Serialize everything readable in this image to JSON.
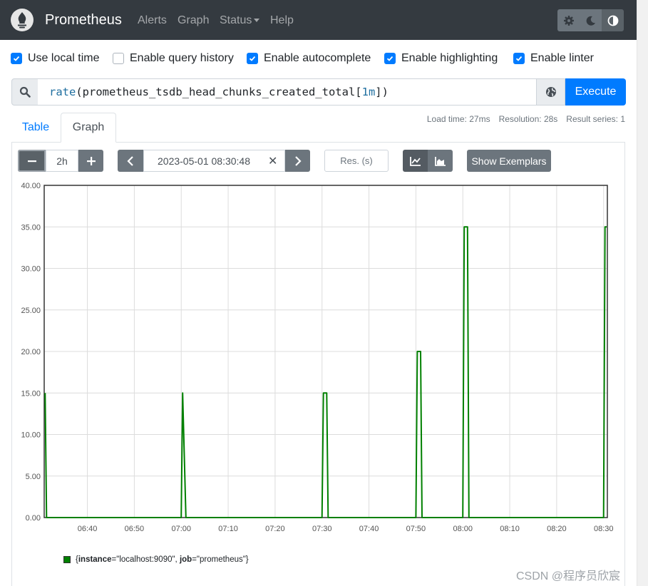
{
  "navbar": {
    "brand": "Prometheus",
    "links": [
      "Alerts",
      "Graph",
      "Status",
      "Help"
    ],
    "theme_icons": [
      "gear-icon",
      "moon-icon",
      "contrast-icon"
    ]
  },
  "options": [
    {
      "label": "Use local time",
      "checked": true
    },
    {
      "label": "Enable query history",
      "checked": false
    },
    {
      "label": "Enable autocomplete",
      "checked": true
    },
    {
      "label": "Enable highlighting",
      "checked": true
    },
    {
      "label": "Enable linter",
      "checked": true
    }
  ],
  "query": {
    "fn": "rate",
    "open": "(",
    "metric": "prometheus_tsdb_head_chunks_created_total",
    "range_open": "[",
    "range": "1m",
    "close": "])",
    "execute_label": "Execute"
  },
  "tabs": {
    "table": "Table",
    "graph": "Graph"
  },
  "stats": {
    "load_time": "Load time: 27ms",
    "resolution": "Resolution: 28s",
    "result_series": "Result series: 1"
  },
  "controls": {
    "range": "2h",
    "end_time": "2023-05-01 08:30:48",
    "res_placeholder": "Res. (s)",
    "exemplars_label": "Show Exemplars"
  },
  "legend": {
    "open": "{",
    "k1": "instance",
    "v1": "=\"localhost:9090\", ",
    "k2": "job",
    "v2": "=\"prometheus\"}"
  },
  "watermark": "CSDN @程序员欣宸",
  "colors": {
    "series": "#008000",
    "accent": "#007bff",
    "navbar": "#343a40"
  },
  "chart_data": {
    "type": "line",
    "y_ticks": [
      "0.00",
      "5.00",
      "10.00",
      "15.00",
      "20.00",
      "25.00",
      "30.00",
      "35.00",
      "40.00"
    ],
    "x_ticks": [
      "06:40",
      "06:50",
      "07:00",
      "07:10",
      "07:20",
      "07:30",
      "07:40",
      "07:50",
      "08:00",
      "08:10",
      "08:20",
      "08:30"
    ],
    "ylim": [
      0,
      40
    ],
    "grid": true,
    "series": [
      {
        "name": "{instance=\"localhost:9090\", job=\"prometheus\"}",
        "x": [
          "06:31",
          "06:31",
          "06:31",
          "07:00",
          "07:00",
          "07:01",
          "07:30",
          "07:30",
          "07:31",
          "07:31",
          "07:50",
          "07:50",
          "07:51",
          "07:51",
          "08:00",
          "08:00",
          "08:01",
          "08:01",
          "08:30",
          "08:30",
          "08:31"
        ],
        "values": [
          15,
          0,
          0,
          0,
          15,
          0,
          0,
          15,
          15,
          0,
          0,
          20,
          20,
          0,
          0,
          35,
          35,
          0,
          0,
          35,
          35
        ]
      }
    ]
  }
}
